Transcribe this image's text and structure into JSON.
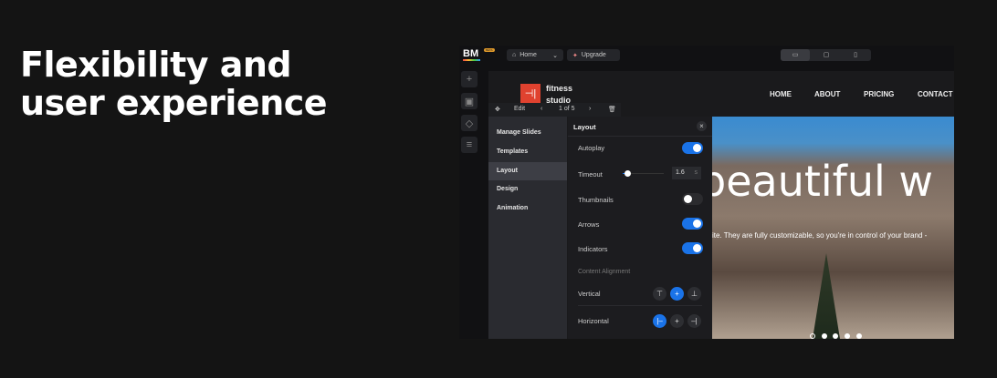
{
  "headline": [
    "Flexibility and",
    "user experience"
  ],
  "topbar": {
    "logo": "BM",
    "badge": "BETA",
    "home": "Home",
    "upgrade": "Upgrade"
  },
  "site": {
    "brand_line1": "fitness",
    "brand_line2": "studio",
    "nav": [
      "HOME",
      "ABOUT",
      "PRICING",
      "CONTACT"
    ]
  },
  "edit_toolbar": {
    "edit": "Edit",
    "pager": "1 of 5"
  },
  "left_panel": [
    "Manage Slides",
    "Templates",
    "Layout",
    "Design",
    "Animation"
  ],
  "settings": {
    "title": "Layout",
    "autoplay": "Autoplay",
    "autoplay_on": true,
    "timeout": "Timeout",
    "timeout_value": "1.6",
    "timeout_unit": "s",
    "thumbnails": "Thumbnails",
    "thumbnails_on": false,
    "arrows": "Arrows",
    "arrows_on": true,
    "indicators": "Indicators",
    "indicators_on": true,
    "content_alignment": "Content Alignment",
    "vertical": "Vertical",
    "horizontal": "Horizontal"
  },
  "hero": {
    "title": "beautiful w",
    "subtitle": "ite. They are fully customizable, so you're in control of your brand -",
    "slides": 5,
    "active_slide": 1
  },
  "colors": {
    "accent": "#1a73e8",
    "logo": "#e0422f"
  }
}
